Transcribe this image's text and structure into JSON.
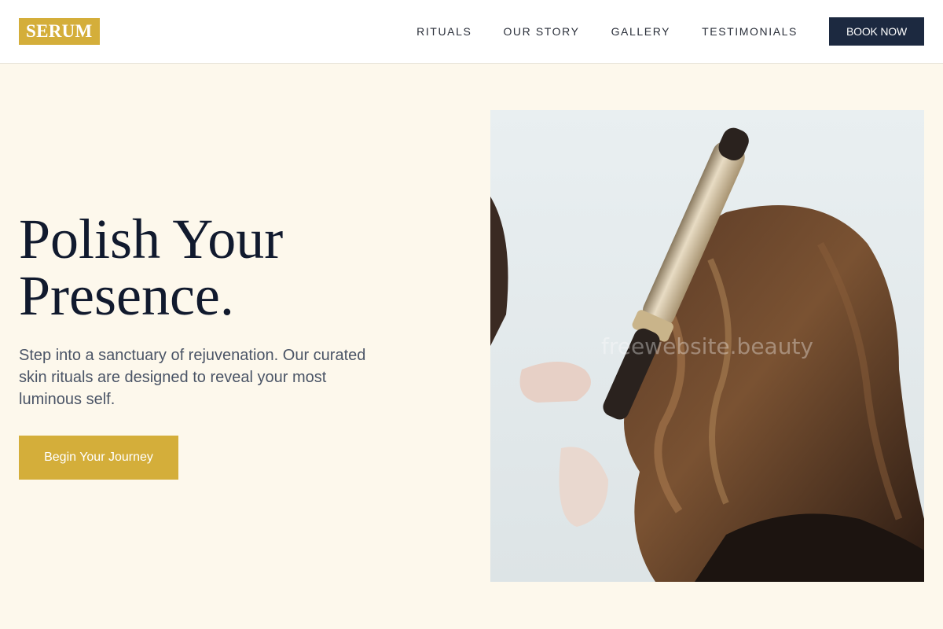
{
  "header": {
    "logo": "SERUM",
    "nav": [
      "RITUALS",
      "OUR STORY",
      "GALLERY",
      "TESTIMONIALS"
    ],
    "book_label": "BOOK NOW"
  },
  "hero": {
    "title_line1": "Polish Your",
    "title_line2": "Presence.",
    "text": "Step into a sanctuary of rejuvenation. Our curated skin rituals are designed to reveal your most luminous self.",
    "cta_label": "Begin Your Journey",
    "image_watermark": "freewebsite.beauty"
  },
  "colors": {
    "accent": "#d4ae3a",
    "navy": "#1c2940",
    "background": "#fdf8ec"
  }
}
